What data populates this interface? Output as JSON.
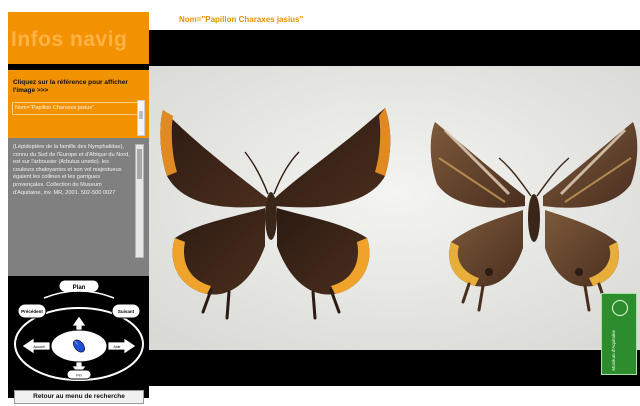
{
  "sidebar": {
    "brand": "Infos navig",
    "click_hint": "Cliquez sur la référence pour afficher l'image  >>>",
    "selected_reference": "Nom=\"Papillon Charaxes jasius\"",
    "description": "(Lépidoptère de la famille des Nymphalidae), connu du Sud de l'Europe et d'Afrique du Nord, est sur l'arbousier (Arbutus unedo). les couleurs chatoyantes et son vol majestueux égaient les collines et les garrigues provençales. Collection du Museum d'Aquitaine, inv. MR, 2001. 502-500 0027",
    "back_button": "Retour au menu de recherche"
  },
  "nav_diagram": {
    "center_icon": "mouse-icon",
    "labels": [
      "Plan",
      "Précédent",
      "Suivant",
      "Accueil",
      "Aide",
      "Fin"
    ]
  },
  "image": {
    "title": "Nom=\"Papillon Charaxes jasius\"",
    "tag_text": "Muséum d'Aquitaine"
  },
  "colors": {
    "accent": "#f39200",
    "panel_gray": "#808080",
    "title_orange": "#e59400",
    "tag_green": "#2d8d2d"
  }
}
